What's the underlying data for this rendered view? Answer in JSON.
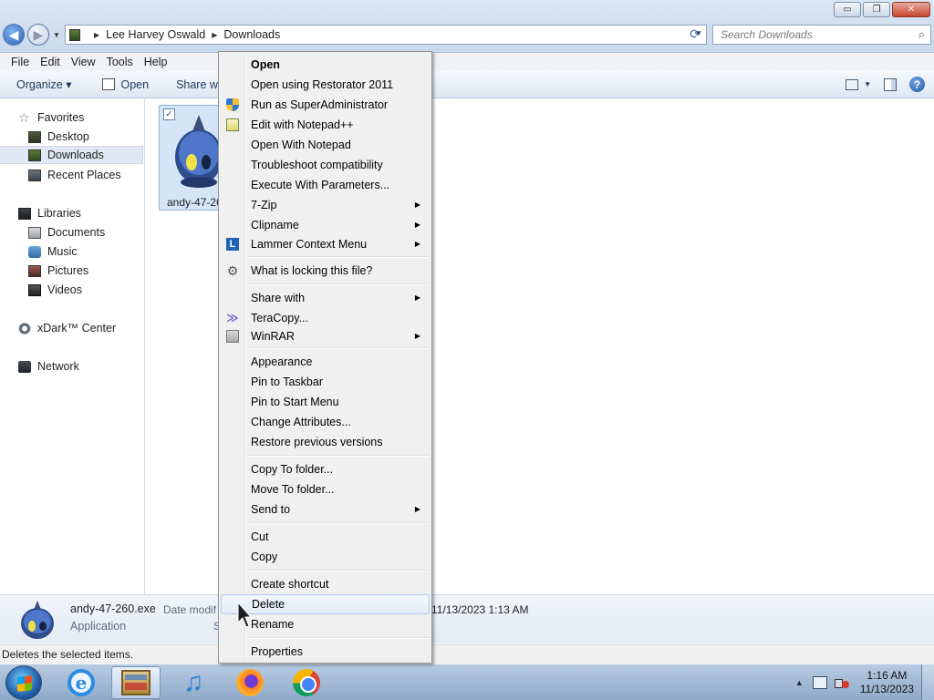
{
  "window": {
    "controls": {
      "minimize": "▭",
      "maximize": "❐",
      "close": "✕"
    }
  },
  "address": {
    "back_glyph": "◀",
    "forward_glyph": "▶",
    "path": [
      "Lee Harvey Oswald",
      "Downloads"
    ],
    "separator": "▶",
    "dropdown_glyph": "▼",
    "refresh_glyph": "⟳",
    "search_placeholder": "Search Downloads"
  },
  "menubar": [
    "File",
    "Edit",
    "View",
    "Tools",
    "Help"
  ],
  "commandbar": {
    "organize": "Organize ▾",
    "open": "Open",
    "share_with": "Share with",
    "help_glyph": "?"
  },
  "navigation": {
    "favorites": {
      "label": "Favorites",
      "items": [
        "Desktop",
        "Downloads",
        "Recent Places"
      ]
    },
    "libraries": {
      "label": "Libraries",
      "items": [
        "Documents",
        "Music",
        "Pictures",
        "Videos"
      ]
    },
    "xdark": "xDark™ Center",
    "network": "Network"
  },
  "files": [
    {
      "name": "andy-47-26",
      "checked": "✓",
      "icon": "app-icon"
    }
  ],
  "details": {
    "name": "andy-47-260.exe",
    "type": "Application",
    "modified_label": "Date modif",
    "size_label_glyph": "S",
    "modified_value": "11/13/2023 1:13 AM"
  },
  "statusbar": {
    "text": "Deletes the selected items."
  },
  "context_menu": {
    "items": [
      {
        "label": "Open",
        "bold": true
      },
      {
        "label": "Open using Restorator 2011"
      },
      {
        "label": "Run as SuperAdministrator",
        "icon": "shield-icon"
      },
      {
        "label": "Edit with Notepad++",
        "icon": "notepad-plus-plus-icon"
      },
      {
        "label": "Open With Notepad"
      },
      {
        "label": "Troubleshoot compatibility"
      },
      {
        "label": "Execute With Parameters..."
      },
      {
        "label": "7-Zip",
        "submenu": true
      },
      {
        "label": "Clipname",
        "submenu": true
      },
      {
        "label": "Lammer Context Menu",
        "submenu": true,
        "icon": "lammer-icon"
      },
      {
        "label": "What is locking this file?",
        "icon": "lock-search-icon"
      },
      {
        "label": "Share with",
        "submenu": true
      },
      {
        "label": "TeraCopy...",
        "icon": "teracopy-icon"
      },
      {
        "label": "WinRAR",
        "submenu": true,
        "icon": "winrar-icon"
      },
      {
        "label": "Appearance"
      },
      {
        "label": "Pin to Taskbar"
      },
      {
        "label": "Pin to Start Menu"
      },
      {
        "label": "Change Attributes..."
      },
      {
        "label": "Restore previous versions"
      },
      {
        "label": "Copy To folder..."
      },
      {
        "label": "Move To folder..."
      },
      {
        "label": "Send to",
        "submenu": true
      },
      {
        "label": "Cut"
      },
      {
        "label": "Copy"
      },
      {
        "label": "Create shortcut"
      },
      {
        "label": "Delete",
        "hovered": true
      },
      {
        "label": "Rename"
      },
      {
        "label": "Properties"
      }
    ],
    "submenu_glyph": "▶",
    "lammer_glyph": "L",
    "lock_glyph": "⚙",
    "teracopy_glyph": "≫"
  },
  "taskbar": {
    "apps": [
      "internet-explorer",
      "windows-explorer",
      "itunes",
      "firefox",
      "chrome"
    ],
    "ie_glyph": "e",
    "music_glyph": "♫",
    "tray_arrow": "▲",
    "time": "1:16 AM",
    "date": "11/13/2023"
  },
  "colors": {
    "accent": "#2a63b8",
    "hover_border": "#aecaf0",
    "selected_nav": "#dfe8f3"
  }
}
